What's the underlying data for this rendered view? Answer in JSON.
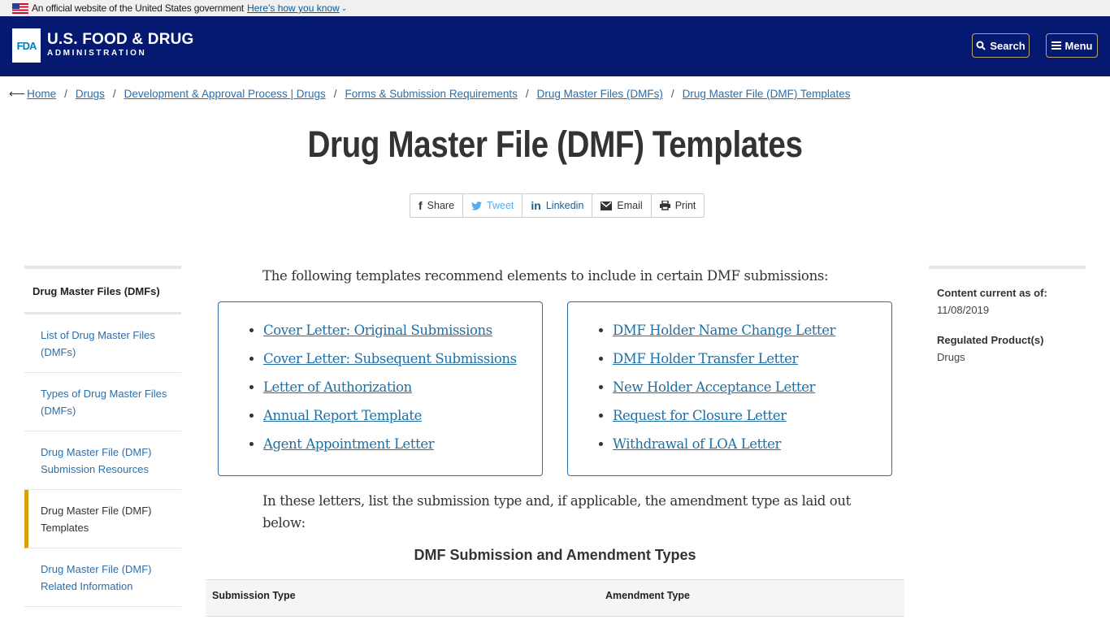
{
  "gov_banner": {
    "text": "An official website of the United States government",
    "link": "Here's how you know"
  },
  "header": {
    "logo_mark": "FDA",
    "title": "U.S. FOOD & DRUG",
    "subtitle": "ADMINISTRATION",
    "search_label": "Search",
    "menu_label": "Menu"
  },
  "breadcrumb": [
    "Home",
    "Drugs",
    "Development & Approval Process | Drugs",
    "Forms & Submission Requirements",
    "Drug Master Files (DMFs)",
    "Drug Master File (DMF) Templates"
  ],
  "page_title": "Drug Master File (DMF) Templates",
  "share": {
    "share": "Share",
    "tweet": "Tweet",
    "linkedin": "Linkedin",
    "email": "Email",
    "print": "Print"
  },
  "sidebar": {
    "heading": "Drug Master Files (DMFs)",
    "items": [
      {
        "label": "List of Drug Master Files (DMFs)",
        "active": false
      },
      {
        "label": "Types of Drug Master Files (DMFs)",
        "active": false
      },
      {
        "label": "Drug Master File (DMF) Submission Resources",
        "active": false
      },
      {
        "label": "Drug Master File (DMF) Templates",
        "active": true
      },
      {
        "label": "Drug Master File (DMF) Related Information",
        "active": false
      }
    ]
  },
  "main": {
    "intro": "The following templates recommend elements to include in certain DMF submissions:",
    "left_links": [
      "Cover Letter: Original Submissions",
      "Cover Letter: Subsequent Submissions",
      "Letter of Authorization",
      "Annual Report Template",
      "Agent Appointment Letter"
    ],
    "right_links": [
      "DMF Holder Name Change Letter",
      "DMF Holder Transfer Letter",
      "New Holder Acceptance Letter",
      "Request for Closure Letter",
      "Withdrawal of LOA Letter"
    ],
    "para2": "In these letters, list the submission type and, if applicable, the amendment type as laid out below:",
    "table_title": "DMF Submission and Amendment Types",
    "table_headers": [
      "Submission Type",
      "Amendment Type"
    ]
  },
  "meta": {
    "content_label": "Content current as of:",
    "content_date": "11/08/2019",
    "regulated_label": "Regulated Product(s)",
    "regulated_value": "Drugs"
  },
  "colors": {
    "header_bg": "#051970",
    "link": "#2a6eab",
    "active_marker": "#d4a20d"
  }
}
